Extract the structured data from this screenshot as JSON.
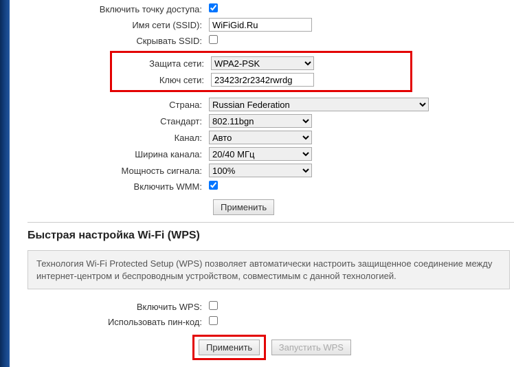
{
  "ap": {
    "enable_label": "Включить точку доступа:",
    "enable_checked": true,
    "ssid_label": "Имя сети (SSID):",
    "ssid_value": "WiFiGid.Ru",
    "hide_ssid_label": "Скрывать SSID:",
    "hide_ssid_checked": false,
    "security_label": "Защита сети:",
    "security_value": "WPA2-PSK",
    "key_label": "Ключ сети:",
    "key_value": "23423r2r2342rwrdg",
    "country_label": "Страна:",
    "country_value": "Russian Federation",
    "standard_label": "Стандарт:",
    "standard_value": "802.11bgn",
    "channel_label": "Канал:",
    "channel_value": "Авто",
    "width_label": "Ширина канала:",
    "width_value": "20/40 МГц",
    "power_label": "Мощность сигнала:",
    "power_value": "100%",
    "wmm_label": "Включить WMM:",
    "wmm_checked": true,
    "apply_label": "Применить"
  },
  "wps": {
    "heading": "Быстрая настройка Wi-Fi (WPS)",
    "info_text": "Технология Wi-Fi Protected Setup (WPS) позволяет автоматически настроить защищенное соединение между интернет-центром и беспроводным устройством, совместимым с данной технологией.",
    "enable_label": "Включить WPS:",
    "enable_checked": false,
    "pin_label": "Использовать пин-код:",
    "pin_checked": false,
    "apply_label": "Применить",
    "start_label": "Запустить WPS"
  }
}
